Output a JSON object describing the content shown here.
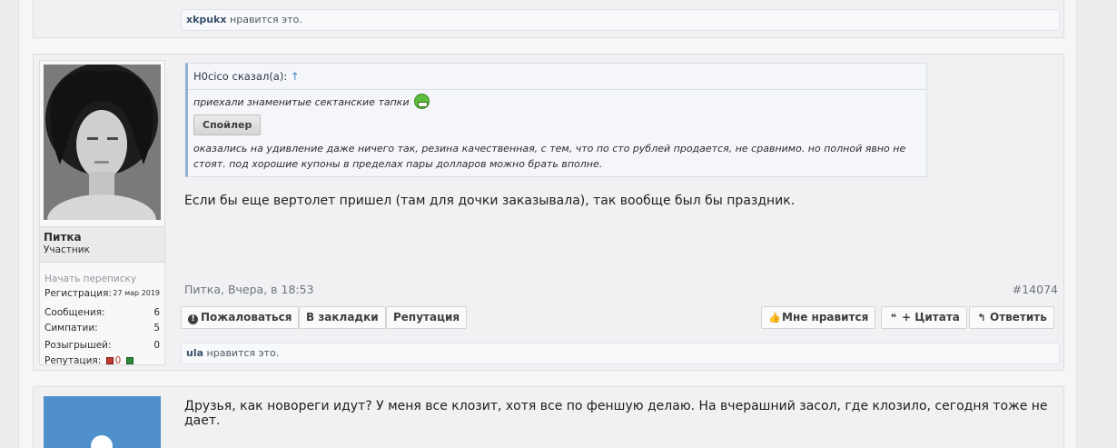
{
  "prev_post": {
    "likes_user": "xkpukx",
    "likes_text": " нравится это."
  },
  "post": {
    "user": {
      "name": "Питка",
      "title": "Участник",
      "start_conversation": "Начать переписку",
      "stats": [
        {
          "label": "Регистрация:",
          "value": "27 мар 2019"
        },
        {
          "label": "Сообщения:",
          "value": "6"
        },
        {
          "label": "Симпатии:",
          "value": "5"
        },
        {
          "label": "Розыгрышей:",
          "value": "0"
        }
      ],
      "reputation_label": "Репутация:",
      "reputation_value": "0"
    },
    "quote": {
      "author": "H0cico сказал(а):",
      "up_arrow": "↑",
      "line1": "приехали знаменитые сектанские тапки",
      "spoiler_label": "Спойлер",
      "line2": "оказались на удивление даже ничего так, резина качественная, с тем, что по сто рублей продается, не сравнимо. но полной явно не стоят. под хорошие купоны в пределах пары долларов можно брать вполне."
    },
    "message": "Если бы еще вертолет пришел (там для дочки заказывала), так вообще был бы праздник.",
    "meta": "Питка, Вчера, в 18:53",
    "post_number": "#14074",
    "buttons_left": [
      {
        "icon": "!",
        "label": "Пожаловаться"
      },
      {
        "label": "В закладки"
      },
      {
        "label": "Репутация"
      }
    ],
    "buttons_right": [
      {
        "icon": "👍",
        "label": "Мне нравится"
      },
      {
        "icon": "❝",
        "label": "+ Цитата"
      },
      {
        "icon": "↰",
        "label": "Ответить"
      }
    ],
    "likes_user": "ula",
    "likes_text": " нравится это."
  },
  "next_post": {
    "message": "Друзья, как новореги идут? У меня все клозит, хотя все по феншую делаю. На вчерашний засол, где клозило, сегодня тоже не дает."
  },
  "colors": {
    "accent": "#3a83c4",
    "rep_negative": "#c0392b",
    "rep_positive": "#2e8b3a"
  }
}
